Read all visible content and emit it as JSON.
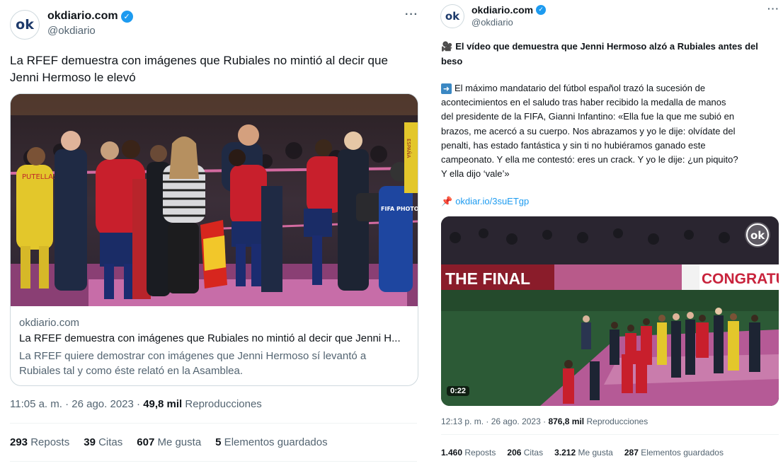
{
  "left": {
    "display_name": "okdiario.com",
    "handle": "@okdiario",
    "avatar_text": "ok",
    "text_line1": "La RFEF demuestra con imágenes que Rubiales no mintió al decir que",
    "text_line2": "Jenni Hermoso le elevó",
    "card": {
      "domain": "okdiario.com",
      "title": "La RFEF demuestra con imágenes que Rubiales no mintió al decir que Jenni H...",
      "description_line1": "La RFEF quiere demostrar con imágenes que Jenni Hermoso sí levantó a",
      "description_line2": "Rubiales tal y como éste relató en la Asamblea."
    },
    "photo_texts": {
      "fifa_badge": "FIFA PHOTO",
      "shirt_back": "PUTELLAS",
      "scarf": "ESPAÑA"
    },
    "meta": {
      "time": "11:05 a. m. · 26 ago. 2023 · ",
      "views": "49,8 mil",
      "views_label": " Reproducciones"
    },
    "stats": [
      {
        "value": "293",
        "label": " Reposts"
      },
      {
        "value": "39",
        "label": " Citas"
      },
      {
        "value": "607",
        "label": " Me gusta"
      },
      {
        "value": "5",
        "label": " Elementos guardados"
      }
    ]
  },
  "right": {
    "display_name": "okdiario.com",
    "handle": "@okdiario",
    "avatar_text": "ok",
    "headline_line1": "El vídeo que demuestra que Jenni Hermoso alzó a Rubiales antes del",
    "headline_line2": "beso",
    "body_lines": [
      "El máximo mandatario del fútbol español trazó la sucesión de",
      "acontecimientos en el saludo tras haber recibido la medalla de manos",
      "del presidente de la FIFA, Gianni Infantino: «Ella fue la que me subió en",
      "brazos, me acercó a su cuerpo. Nos abrazamos y yo le dije: olvídate del",
      "penalti, has estado fantástica y sin ti no hubiéramos ganado este",
      "campeonato. Y ella me contestó: eres un crack. Y yo le dije: ¿un piquito?",
      "Y ella dijo ‘vale’»"
    ],
    "link": "okdiar.io/3suETgp",
    "video": {
      "banner_left": "THE FINAL",
      "banner_right": "CONGRATU",
      "logo": "ok",
      "duration": "0:22"
    },
    "meta": {
      "time": "12:13 p. m. · 26 ago. 2023 · ",
      "views": "876,8 mil",
      "views_label": " Reproducciones"
    },
    "stats": [
      {
        "value": "1.460",
        "label": " Reposts"
      },
      {
        "value": "206",
        "label": " Citas"
      },
      {
        "value": "3.212",
        "label": " Me gusta"
      },
      {
        "value": "287",
        "label": " Elementos guardados"
      }
    ]
  },
  "colors": {
    "text": "#0f1419",
    "secondary": "#536471",
    "link": "#1d9bf0",
    "verified": "#1d9bf0"
  }
}
